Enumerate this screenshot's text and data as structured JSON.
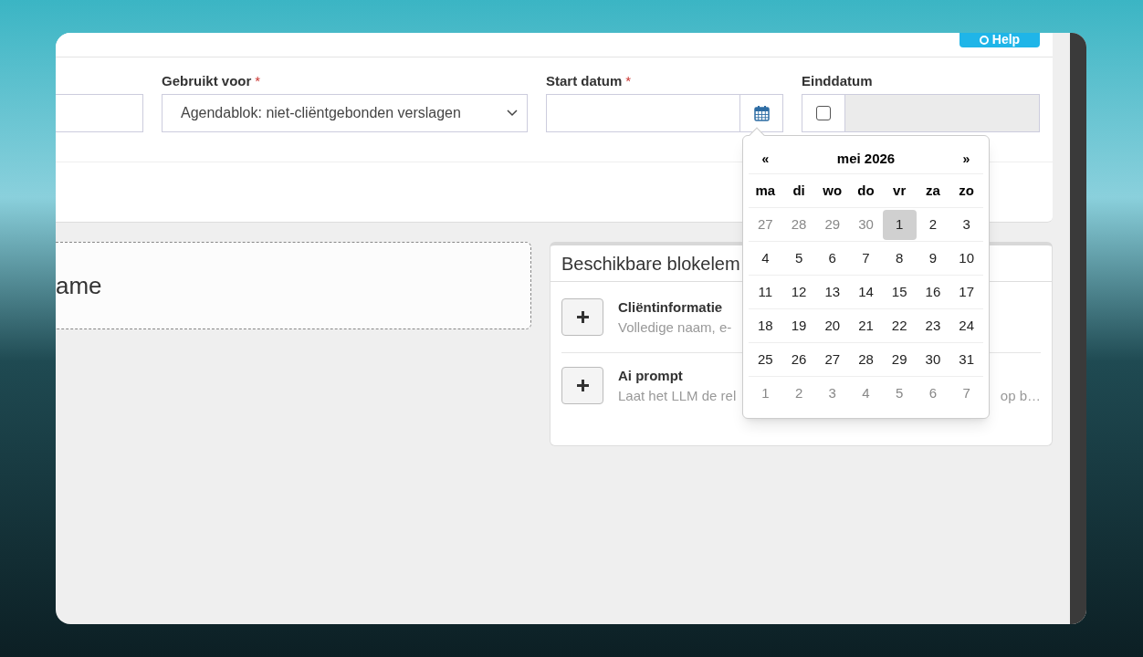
{
  "header": {
    "help_button": "Help"
  },
  "form": {
    "used_for": {
      "label": "Gebruikt voor",
      "required_mark": "*",
      "value": "Agendablok: niet-cliëntgebonden verslagen"
    },
    "start_date": {
      "label": "Start datum",
      "required_mark": "*"
    },
    "end_date": {
      "label": "Einddatum",
      "checked": false,
      "disabled": true
    }
  },
  "name_box": {
    "text": "ame"
  },
  "blocks_panel": {
    "title": "Beschikbare blokelem",
    "items": [
      {
        "title": "Cliëntinformatie",
        "description": "Volledige naam, e-"
      },
      {
        "title": "Ai prompt",
        "description": "Laat het LLM de rel",
        "description_tail": "op b…"
      }
    ]
  },
  "datepicker": {
    "prev": "«",
    "title": "mei 2026",
    "next": "»",
    "weekdays": [
      "ma",
      "di",
      "wo",
      "do",
      "vr",
      "za",
      "zo"
    ],
    "weeks": [
      [
        {
          "day": "27",
          "outside": true,
          "hovered": false
        },
        {
          "day": "28",
          "outside": true,
          "hovered": false
        },
        {
          "day": "29",
          "outside": true,
          "hovered": false
        },
        {
          "day": "30",
          "outside": true,
          "hovered": false
        },
        {
          "day": "1",
          "outside": false,
          "hovered": true
        },
        {
          "day": "2",
          "outside": false,
          "hovered": false
        },
        {
          "day": "3",
          "outside": false,
          "hovered": false
        }
      ],
      [
        {
          "day": "4",
          "outside": false,
          "hovered": false
        },
        {
          "day": "5",
          "outside": false,
          "hovered": false
        },
        {
          "day": "6",
          "outside": false,
          "hovered": false
        },
        {
          "day": "7",
          "outside": false,
          "hovered": false
        },
        {
          "day": "8",
          "outside": false,
          "hovered": false
        },
        {
          "day": "9",
          "outside": false,
          "hovered": false
        },
        {
          "day": "10",
          "outside": false,
          "hovered": false
        }
      ],
      [
        {
          "day": "11",
          "outside": false,
          "hovered": false
        },
        {
          "day": "12",
          "outside": false,
          "hovered": false
        },
        {
          "day": "13",
          "outside": false,
          "hovered": false
        },
        {
          "day": "14",
          "outside": false,
          "hovered": false
        },
        {
          "day": "15",
          "outside": false,
          "hovered": false
        },
        {
          "day": "16",
          "outside": false,
          "hovered": false
        },
        {
          "day": "17",
          "outside": false,
          "hovered": false
        }
      ],
      [
        {
          "day": "18",
          "outside": false,
          "hovered": false
        },
        {
          "day": "19",
          "outside": false,
          "hovered": false
        },
        {
          "day": "20",
          "outside": false,
          "hovered": false
        },
        {
          "day": "21",
          "outside": false,
          "hovered": false
        },
        {
          "day": "22",
          "outside": false,
          "hovered": false
        },
        {
          "day": "23",
          "outside": false,
          "hovered": false
        },
        {
          "day": "24",
          "outside": false,
          "hovered": false
        }
      ],
      [
        {
          "day": "25",
          "outside": false,
          "hovered": false
        },
        {
          "day": "26",
          "outside": false,
          "hovered": false
        },
        {
          "day": "27",
          "outside": false,
          "hovered": false
        },
        {
          "day": "28",
          "outside": false,
          "hovered": false
        },
        {
          "day": "29",
          "outside": false,
          "hovered": false
        },
        {
          "day": "30",
          "outside": false,
          "hovered": false
        },
        {
          "day": "31",
          "outside": false,
          "hovered": false
        }
      ],
      [
        {
          "day": "1",
          "outside": true,
          "hovered": false
        },
        {
          "day": "2",
          "outside": true,
          "hovered": false
        },
        {
          "day": "3",
          "outside": true,
          "hovered": false
        },
        {
          "day": "4",
          "outside": true,
          "hovered": false
        },
        {
          "day": "5",
          "outside": true,
          "hovered": false
        },
        {
          "day": "6",
          "outside": true,
          "hovered": false
        },
        {
          "day": "7",
          "outside": true,
          "hovered": false
        }
      ]
    ]
  }
}
